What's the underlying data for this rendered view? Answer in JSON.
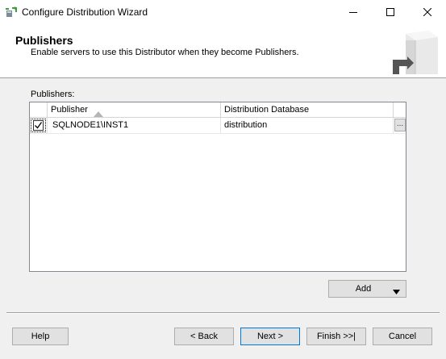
{
  "window": {
    "title": "Configure Distribution Wizard",
    "controls": [
      "minimize-icon",
      "maximize-icon",
      "close-icon"
    ]
  },
  "header": {
    "title": "Publishers",
    "subtitle": "Enable servers to use this Distributor when they become Publishers."
  },
  "publishers": {
    "label": "Publishers:",
    "columns": [
      "Publisher",
      "Distribution Database"
    ],
    "sort_column": "Publisher",
    "rows": [
      {
        "checked": true,
        "publisher": "SQLNODE1\\INST1",
        "distribution_database": "distribution",
        "browse_label": "..."
      }
    ]
  },
  "buttons": {
    "add": "Add",
    "help": "Help",
    "back": "< Back",
    "next": "Next >",
    "finish": "Finish >>|",
    "cancel": "Cancel"
  },
  "colors": {
    "accent": "#0078d7",
    "background": "#f0f0f0",
    "header_background": "#ffffff"
  }
}
